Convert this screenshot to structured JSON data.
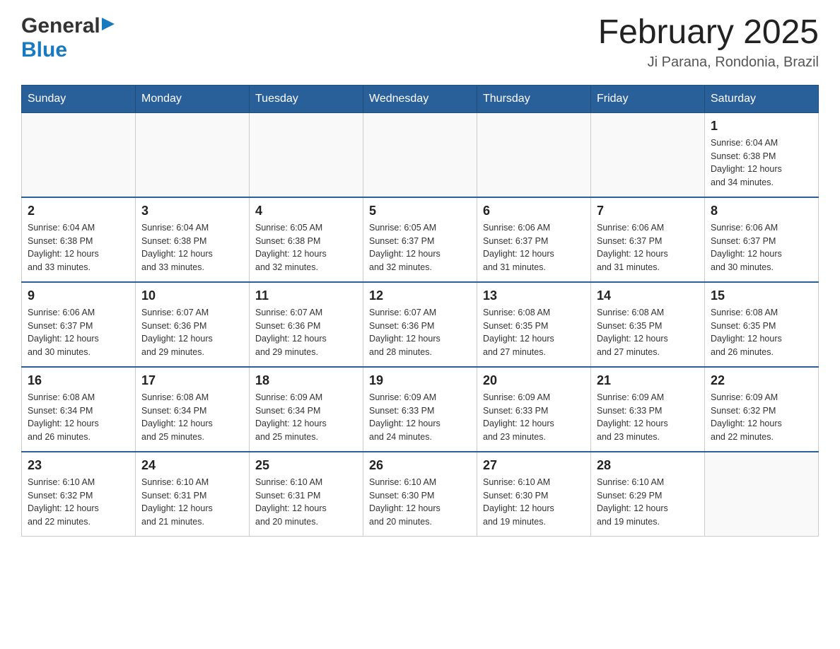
{
  "header": {
    "logo_general": "General",
    "logo_blue": "Blue",
    "title": "February 2025",
    "subtitle": "Ji Parana, Rondonia, Brazil"
  },
  "days_of_week": [
    "Sunday",
    "Monday",
    "Tuesday",
    "Wednesday",
    "Thursday",
    "Friday",
    "Saturday"
  ],
  "weeks": [
    [
      {
        "day": "",
        "info": ""
      },
      {
        "day": "",
        "info": ""
      },
      {
        "day": "",
        "info": ""
      },
      {
        "day": "",
        "info": ""
      },
      {
        "day": "",
        "info": ""
      },
      {
        "day": "",
        "info": ""
      },
      {
        "day": "1",
        "info": "Sunrise: 6:04 AM\nSunset: 6:38 PM\nDaylight: 12 hours\nand 34 minutes."
      }
    ],
    [
      {
        "day": "2",
        "info": "Sunrise: 6:04 AM\nSunset: 6:38 PM\nDaylight: 12 hours\nand 33 minutes."
      },
      {
        "day": "3",
        "info": "Sunrise: 6:04 AM\nSunset: 6:38 PM\nDaylight: 12 hours\nand 33 minutes."
      },
      {
        "day": "4",
        "info": "Sunrise: 6:05 AM\nSunset: 6:38 PM\nDaylight: 12 hours\nand 32 minutes."
      },
      {
        "day": "5",
        "info": "Sunrise: 6:05 AM\nSunset: 6:37 PM\nDaylight: 12 hours\nand 32 minutes."
      },
      {
        "day": "6",
        "info": "Sunrise: 6:06 AM\nSunset: 6:37 PM\nDaylight: 12 hours\nand 31 minutes."
      },
      {
        "day": "7",
        "info": "Sunrise: 6:06 AM\nSunset: 6:37 PM\nDaylight: 12 hours\nand 31 minutes."
      },
      {
        "day": "8",
        "info": "Sunrise: 6:06 AM\nSunset: 6:37 PM\nDaylight: 12 hours\nand 30 minutes."
      }
    ],
    [
      {
        "day": "9",
        "info": "Sunrise: 6:06 AM\nSunset: 6:37 PM\nDaylight: 12 hours\nand 30 minutes."
      },
      {
        "day": "10",
        "info": "Sunrise: 6:07 AM\nSunset: 6:36 PM\nDaylight: 12 hours\nand 29 minutes."
      },
      {
        "day": "11",
        "info": "Sunrise: 6:07 AM\nSunset: 6:36 PM\nDaylight: 12 hours\nand 29 minutes."
      },
      {
        "day": "12",
        "info": "Sunrise: 6:07 AM\nSunset: 6:36 PM\nDaylight: 12 hours\nand 28 minutes."
      },
      {
        "day": "13",
        "info": "Sunrise: 6:08 AM\nSunset: 6:35 PM\nDaylight: 12 hours\nand 27 minutes."
      },
      {
        "day": "14",
        "info": "Sunrise: 6:08 AM\nSunset: 6:35 PM\nDaylight: 12 hours\nand 27 minutes."
      },
      {
        "day": "15",
        "info": "Sunrise: 6:08 AM\nSunset: 6:35 PM\nDaylight: 12 hours\nand 26 minutes."
      }
    ],
    [
      {
        "day": "16",
        "info": "Sunrise: 6:08 AM\nSunset: 6:34 PM\nDaylight: 12 hours\nand 26 minutes."
      },
      {
        "day": "17",
        "info": "Sunrise: 6:08 AM\nSunset: 6:34 PM\nDaylight: 12 hours\nand 25 minutes."
      },
      {
        "day": "18",
        "info": "Sunrise: 6:09 AM\nSunset: 6:34 PM\nDaylight: 12 hours\nand 25 minutes."
      },
      {
        "day": "19",
        "info": "Sunrise: 6:09 AM\nSunset: 6:33 PM\nDaylight: 12 hours\nand 24 minutes."
      },
      {
        "day": "20",
        "info": "Sunrise: 6:09 AM\nSunset: 6:33 PM\nDaylight: 12 hours\nand 23 minutes."
      },
      {
        "day": "21",
        "info": "Sunrise: 6:09 AM\nSunset: 6:33 PM\nDaylight: 12 hours\nand 23 minutes."
      },
      {
        "day": "22",
        "info": "Sunrise: 6:09 AM\nSunset: 6:32 PM\nDaylight: 12 hours\nand 22 minutes."
      }
    ],
    [
      {
        "day": "23",
        "info": "Sunrise: 6:10 AM\nSunset: 6:32 PM\nDaylight: 12 hours\nand 22 minutes."
      },
      {
        "day": "24",
        "info": "Sunrise: 6:10 AM\nSunset: 6:31 PM\nDaylight: 12 hours\nand 21 minutes."
      },
      {
        "day": "25",
        "info": "Sunrise: 6:10 AM\nSunset: 6:31 PM\nDaylight: 12 hours\nand 20 minutes."
      },
      {
        "day": "26",
        "info": "Sunrise: 6:10 AM\nSunset: 6:30 PM\nDaylight: 12 hours\nand 20 minutes."
      },
      {
        "day": "27",
        "info": "Sunrise: 6:10 AM\nSunset: 6:30 PM\nDaylight: 12 hours\nand 19 minutes."
      },
      {
        "day": "28",
        "info": "Sunrise: 6:10 AM\nSunset: 6:29 PM\nDaylight: 12 hours\nand 19 minutes."
      },
      {
        "day": "",
        "info": ""
      }
    ]
  ]
}
